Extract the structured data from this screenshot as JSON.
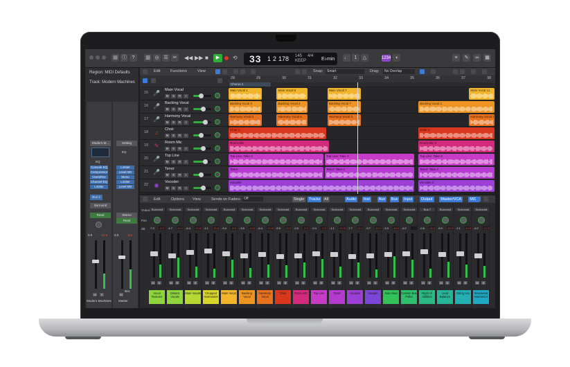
{
  "transport": {
    "position_bar": "33",
    "position_beat": "1",
    "position_sub": "2",
    "position_tick": "178",
    "tempo": "145",
    "tempo_label": "KEEP",
    "signature": "4/4",
    "signature_label": "",
    "key": "E♭min",
    "rewind_icon": "rewind-icon",
    "forward_icon": "fast-forward-icon",
    "stop_icon": "stop-icon",
    "play_icon": "play-icon",
    "record_icon": "record-icon",
    "cycle_icon": "cycle-icon",
    "badge": "1234"
  },
  "inspector": {
    "region_label": "Region: MIDI Defaults",
    "track_label": "Track: Modern Machines",
    "left_strip": {
      "name": "Modern M...",
      "eq_label": "EQ",
      "plugins": [
        "Console EQ",
        "Compressor",
        "Overdrive",
        "Channel EQ",
        "Limiter"
      ],
      "bus": "Bus 2",
      "output": "Surround",
      "automation": "Read",
      "pan_value": "0.0",
      "meter_value": "-10.8",
      "name_footer": "Modern Machines"
    },
    "right_strip": {
      "name": "Setting",
      "eq_label": "EQ",
      "plugins": [
        "Limiter",
        "Level Mtr",
        "Mono",
        "Limiter",
        "Level Mtr"
      ],
      "output": "Stereo",
      "automation": "Read",
      "pan_value": "0.0",
      "meter_value": "-3.6",
      "bounce": "Bnc",
      "name_footer": "Master"
    }
  },
  "tracks_toolbar": {
    "edit": "Edit",
    "functions": "Functions",
    "view": "View",
    "snap_label": "Snap:",
    "snap_value": "Smart",
    "drag_label": "Drag:",
    "drag_value": "No Overlap"
  },
  "ruler": [
    "28",
    "29",
    "30",
    "31",
    "32",
    "33",
    "34",
    "35",
    "36",
    "37",
    "38"
  ],
  "marker": "Chorus 1",
  "tracks": [
    {
      "num": "15",
      "name": "Main Vocal",
      "icon": "microphone-icon",
      "color": "#f2b42a",
      "regions": [
        {
          "name": "Main Vocal 1",
          "start": 0.0,
          "len": 0.13
        },
        {
          "name": "Main Vocal 5",
          "start": 0.18,
          "len": 0.12
        },
        {
          "name": "Main Vocal 7",
          "start": 0.37,
          "len": 0.13
        },
        {
          "name": "Main Vocal 11",
          "start": 0.9,
          "len": 0.1
        }
      ]
    },
    {
      "num": "16",
      "name": "Backing Vocal",
      "icon": "microphone-icon",
      "color": "#ee9423",
      "regions": [
        {
          "name": "Backing Vocal 2",
          "start": 0.0,
          "len": 0.13
        },
        {
          "name": "Backing Vocal 4",
          "start": 0.18,
          "len": 0.12
        },
        {
          "name": "Backing Vocal 7",
          "start": 0.37,
          "len": 0.13
        },
        {
          "name": "Backing Vocal 1",
          "start": 0.71,
          "len": 0.29
        }
      ]
    },
    {
      "num": "17",
      "name": "Harmony Vocal",
      "icon": "microphone-icon",
      "color": "#e8711e",
      "regions": [
        {
          "name": "Harmony Vocal 2",
          "start": 0.0,
          "len": 0.13
        },
        {
          "name": "Harmony Vocal 6",
          "start": 0.18,
          "len": 0.12
        },
        {
          "name": "Harmony Vocal 3",
          "start": 0.37,
          "len": 0.13
        },
        {
          "name": "Harmony Vocal 1",
          "start": 0.9,
          "len": 0.1
        }
      ]
    },
    {
      "num": "18",
      "name": "Choir",
      "icon": "choir-icon",
      "color": "#d9381e",
      "regions": [
        {
          "name": "Choir 1",
          "start": 0.0,
          "len": 0.37
        },
        {
          "name": "Choir 2",
          "start": 0.71,
          "len": 0.29
        }
      ]
    },
    {
      "num": "19",
      "name": "Room Mic",
      "icon": "pencil-icon",
      "color": "#d42a7e",
      "regions": [
        {
          "name": "Room Mic",
          "start": 0.0,
          "len": 0.38
        },
        {
          "name": "Room Mic 2",
          "start": 0.71,
          "len": 0.29
        }
      ]
    },
    {
      "num": "20",
      "name": "Top Line",
      "icon": "microphone-icon",
      "color": "#c63cc8",
      "regions": [
        {
          "name": "Top Line: Take 3",
          "start": 0.0,
          "len": 0.36
        },
        {
          "name": "Top Line: Take 3",
          "start": 0.36,
          "len": 0.34
        },
        {
          "name": "Top Line: Take 3",
          "start": 0.71,
          "len": 0.29
        }
      ]
    },
    {
      "num": "21",
      "name": "Tenor",
      "icon": "microphone-icon",
      "color": "#b53ad0",
      "regions": [
        {
          "name": "Tenor",
          "start": 0.0,
          "len": 0.36
        },
        {
          "name": "Tenor: Take 2",
          "start": 0.36,
          "len": 0.34
        },
        {
          "name": "Tenor: Take 2",
          "start": 0.71,
          "len": 0.29
        }
      ]
    },
    {
      "num": "22",
      "name": "Vocoder",
      "icon": "synth-icon",
      "color": "#9b3fd6",
      "regions": [
        {
          "name": "Vocoder",
          "start": 0.0,
          "len": 0.7
        },
        {
          "name": "Vocoder 2",
          "start": 0.71,
          "len": 0.29
        }
      ]
    }
  ],
  "mixer_toolbar": {
    "edit": "Edit",
    "options": "Options",
    "view": "View",
    "sends_on_faders": "Sends on Faders",
    "off": "Off",
    "single": "Single",
    "tracks": "Tracks",
    "all": "All",
    "filters": [
      "Audio",
      "Inst",
      "Aux",
      "Bus",
      "Input",
      "Output",
      "Master/VCA",
      "MIDI"
    ]
  },
  "mixer_row_labels": {
    "output": "Output",
    "pan": "Pan",
    "db": "dB"
  },
  "channels": [
    {
      "name": "Vocal Textures",
      "color": "#8ed43d",
      "out": "Surround",
      "vol": "-7.0",
      "peak": "-6.3",
      "fader": 0.55,
      "meter": 0.3
    },
    {
      "name": "Distant Vocals",
      "color": "#8ed43d",
      "out": "Surround",
      "vol": "-4.7",
      "peak": "-14.1",
      "fader": 0.5,
      "meter": 0.45
    },
    {
      "name": "Main Vocals",
      "color": "#b7d832",
      "out": "Surround",
      "vol": "-6.4",
      "peak": "-10.8",
      "fader": 0.58,
      "meter": 0.25
    },
    {
      "name": "Chopped Harmonies",
      "color": "#d8d52c",
      "out": "Surround",
      "vol": "-1.1",
      "peak": "-20.6",
      "fader": 0.62,
      "meter": 0.2
    },
    {
      "name": "Main Vocal",
      "color": "#f2b42a",
      "out": "Surround",
      "vol": "-3.4",
      "peak": "-8.6",
      "fader": 0.55,
      "meter": 0.4
    },
    {
      "name": "Backing Vocal",
      "color": "#ee9423",
      "out": "Surround",
      "vol": "-3.5",
      "peak": "-19.5",
      "fader": 0.5,
      "meter": 0.22
    },
    {
      "name": "Harmony Vocal",
      "color": "#e8711e",
      "out": "Surround",
      "vol": "-6.4",
      "peak": "-10.8",
      "fader": 0.52,
      "meter": 0.3
    },
    {
      "name": "Choir",
      "color": "#d9381e",
      "out": "Surround",
      "vol": "-9.9",
      "peak": "-13.2",
      "fader": 0.48,
      "meter": 0.28
    },
    {
      "name": "Room Mic",
      "color": "#d42a7e",
      "out": "Surround",
      "vol": "-2.5",
      "peak": "-9.3",
      "fader": 0.5,
      "meter": 0.34
    },
    {
      "name": "Top Line",
      "color": "#c63cc8",
      "out": "Surround",
      "vol": "-0.4",
      "peak": "-7.4",
      "fader": 0.55,
      "meter": 0.42
    },
    {
      "name": "Tenor",
      "color": "#b53ad0",
      "out": "Surround",
      "vol": "-1.1",
      "peak": "-10.5",
      "fader": 0.52,
      "meter": 0.25
    },
    {
      "name": "Vocoder",
      "color": "#9b3fd6",
      "out": "Surround",
      "vol": "-7.7",
      "peak": "-12.1",
      "fader": 0.47,
      "meter": 0.35
    },
    {
      "name": "Sample",
      "color": "#7d45d8",
      "out": "Surround",
      "vol": "-3.7",
      "peak": "-10.1",
      "fader": 0.5,
      "meter": 0.18
    },
    {
      "name": "Side Heal",
      "color": "#33c25a",
      "out": "Surround",
      "vol": "-3.3",
      "peak": "-18.0",
      "fader": 0.53,
      "meter": 0.48
    },
    {
      "name": "Custom Bus Polka",
      "color": "#2fbf6c",
      "out": "Surround",
      "vol": "-6.2",
      "peak": "",
      "fader": 0.55,
      "meter": 0.4
    },
    {
      "name": "Right of Abilities",
      "color": "#2ab982",
      "out": "Bus 7",
      "vol": "-0.6",
      "peak": "-16.2",
      "fader": 0.6,
      "meter": 0.2
    },
    {
      "name": "Lead Balance",
      "color": "#27b59a",
      "out": "Surround",
      "vol": "-5.0",
      "peak": "-15.0",
      "fader": 0.52,
      "meter": 0.36
    },
    {
      "name": "String Vox",
      "color": "#24afb0",
      "out": "Surround",
      "vol": "-2.1",
      "peak": "-10.6",
      "fader": 0.55,
      "meter": 0.3
    },
    {
      "name": "Woodwind Harmonics",
      "color": "#21a9c3",
      "out": "Surround",
      "vol": "-6.2",
      "peak": "-12.2",
      "fader": 0.5,
      "meter": 0.26
    }
  ]
}
